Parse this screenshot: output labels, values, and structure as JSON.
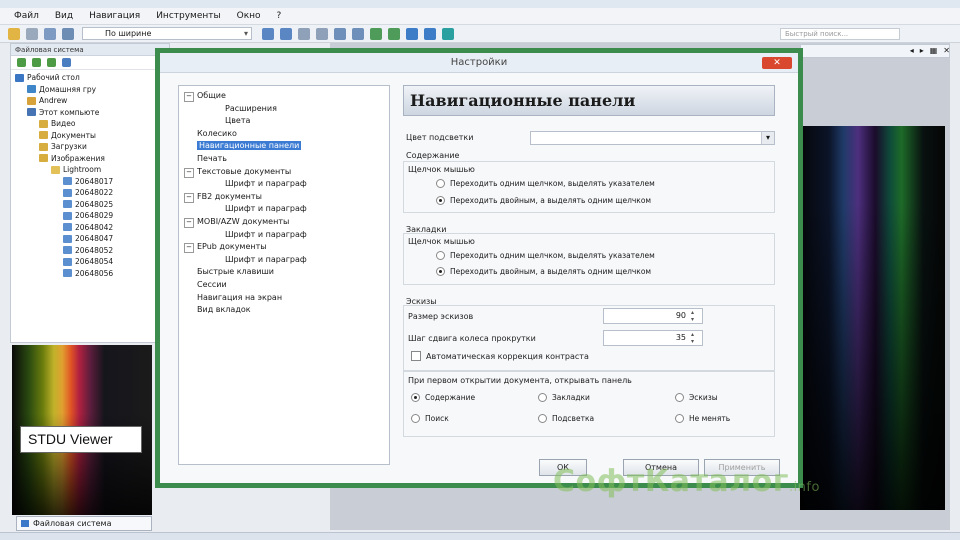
{
  "app": {
    "title": "Настройки"
  },
  "menubar": {
    "items": [
      "Файл",
      "Вид",
      "Навигация",
      "Инструменты",
      "Окно",
      "?"
    ]
  },
  "toolbar": {
    "zoom_value": "По ширине",
    "quick_search_placeholder": "Быстрый поиск..."
  },
  "left_panel": {
    "header": "Файловая система",
    "tree": [
      {
        "label": "Рабочий стол",
        "indent": 0
      },
      {
        "label": "Домашняя гру",
        "indent": 1
      },
      {
        "label": "Andrew",
        "indent": 1
      },
      {
        "label": "Этот компьюте",
        "indent": 1
      },
      {
        "label": "Видео",
        "indent": 2
      },
      {
        "label": "Документы",
        "indent": 2
      },
      {
        "label": "Загрузки",
        "indent": 2
      },
      {
        "label": "Изображения",
        "indent": 2
      },
      {
        "label": "Lightroom",
        "indent": 3
      },
      {
        "label": "20648017",
        "indent": 4
      },
      {
        "label": "20648022",
        "indent": 4
      },
      {
        "label": "20648025",
        "indent": 4
      },
      {
        "label": "20648029",
        "indent": 4
      },
      {
        "label": "20648042",
        "indent": 4
      },
      {
        "label": "20648047",
        "indent": 4
      },
      {
        "label": "20648052",
        "indent": 4
      },
      {
        "label": "20648054",
        "indent": 4
      },
      {
        "label": "20648056",
        "indent": 4
      }
    ],
    "thumbnail_label": "STDU Viewer",
    "bottom_tab": "Файловая система"
  },
  "dialog": {
    "title": "Настройки",
    "close_label": "✕",
    "tree": [
      {
        "label": "Общие",
        "level": 0,
        "expanded": true,
        "selected": false
      },
      {
        "label": "Расширения",
        "level": 1,
        "expanded": false,
        "selected": false
      },
      {
        "label": "Цвета",
        "level": 1,
        "expanded": false,
        "selected": false
      },
      {
        "label": "Колесико",
        "level": 0,
        "expanded": false,
        "selected": false
      },
      {
        "label": "Навигационные панели",
        "level": 0,
        "expanded": false,
        "selected": true
      },
      {
        "label": "Печать",
        "level": 0,
        "expanded": false,
        "selected": false
      },
      {
        "label": "Текстовые документы",
        "level": 0,
        "expanded": true,
        "selected": false
      },
      {
        "label": "Шрифт и параграф",
        "level": 1,
        "expanded": false,
        "selected": false
      },
      {
        "label": "FB2 документы",
        "level": 0,
        "expanded": true,
        "selected": false
      },
      {
        "label": "Шрифт и параграф",
        "level": 1,
        "expanded": false,
        "selected": false
      },
      {
        "label": "MOBI/AZW документы",
        "level": 0,
        "expanded": true,
        "selected": false
      },
      {
        "label": "Шрифт и параграф",
        "level": 1,
        "expanded": false,
        "selected": false
      },
      {
        "label": "EPub документы",
        "level": 0,
        "expanded": true,
        "selected": false
      },
      {
        "label": "Шрифт и параграф",
        "level": 1,
        "expanded": false,
        "selected": false
      },
      {
        "label": "Быстрые клавиши",
        "level": 0,
        "expanded": false,
        "selected": false
      },
      {
        "label": "Сессии",
        "level": 0,
        "expanded": false,
        "selected": false
      },
      {
        "label": "Навигация на экран",
        "level": 0,
        "expanded": false,
        "selected": false
      },
      {
        "label": "Вид вкладок",
        "level": 0,
        "expanded": false,
        "selected": false
      }
    ],
    "panel_title": "Навигационные панели",
    "highlight_color_label": "Цвет подсветки",
    "contents": {
      "section": "Содержание",
      "click_label": "Щелчок мышью",
      "option1": "Переходить одним щелчком, выделять указателем",
      "option2": "Переходить двойным, а выделять одним щелчком",
      "selected": 2
    },
    "bookmarks": {
      "section": "Закладки",
      "click_label": "Щелчок мышью",
      "option1": "Переходить одним щелчком, выделять указателем",
      "option2": "Переходить двойным, а выделять одним щелчком",
      "selected": 2
    },
    "thumbnails": {
      "section": "Эскизы",
      "size_label": "Размер эскизов",
      "size_value": "90",
      "scroll_label": "Шаг сдвига колеса прокрутки",
      "scroll_value": "35",
      "contrast_label": "Автоматическая коррекция контраста",
      "contrast_checked": false
    },
    "open_panel": {
      "label": "При первом открытии документа, открывать панель",
      "options": [
        "Содержание",
        "Закладки",
        "Эскизы",
        "Поиск",
        "Подсветка",
        "Не менять"
      ],
      "selected": 0
    },
    "buttons": {
      "ok": "ОК",
      "cancel": "Отмена",
      "apply": "Применить"
    }
  },
  "watermark": {
    "main": "СофтКаталог",
    "suffix": ".info"
  },
  "colors": {
    "dialog_border": "#3c8c4e",
    "selection": "#3b7bd3",
    "close_button": "#d9472f"
  }
}
